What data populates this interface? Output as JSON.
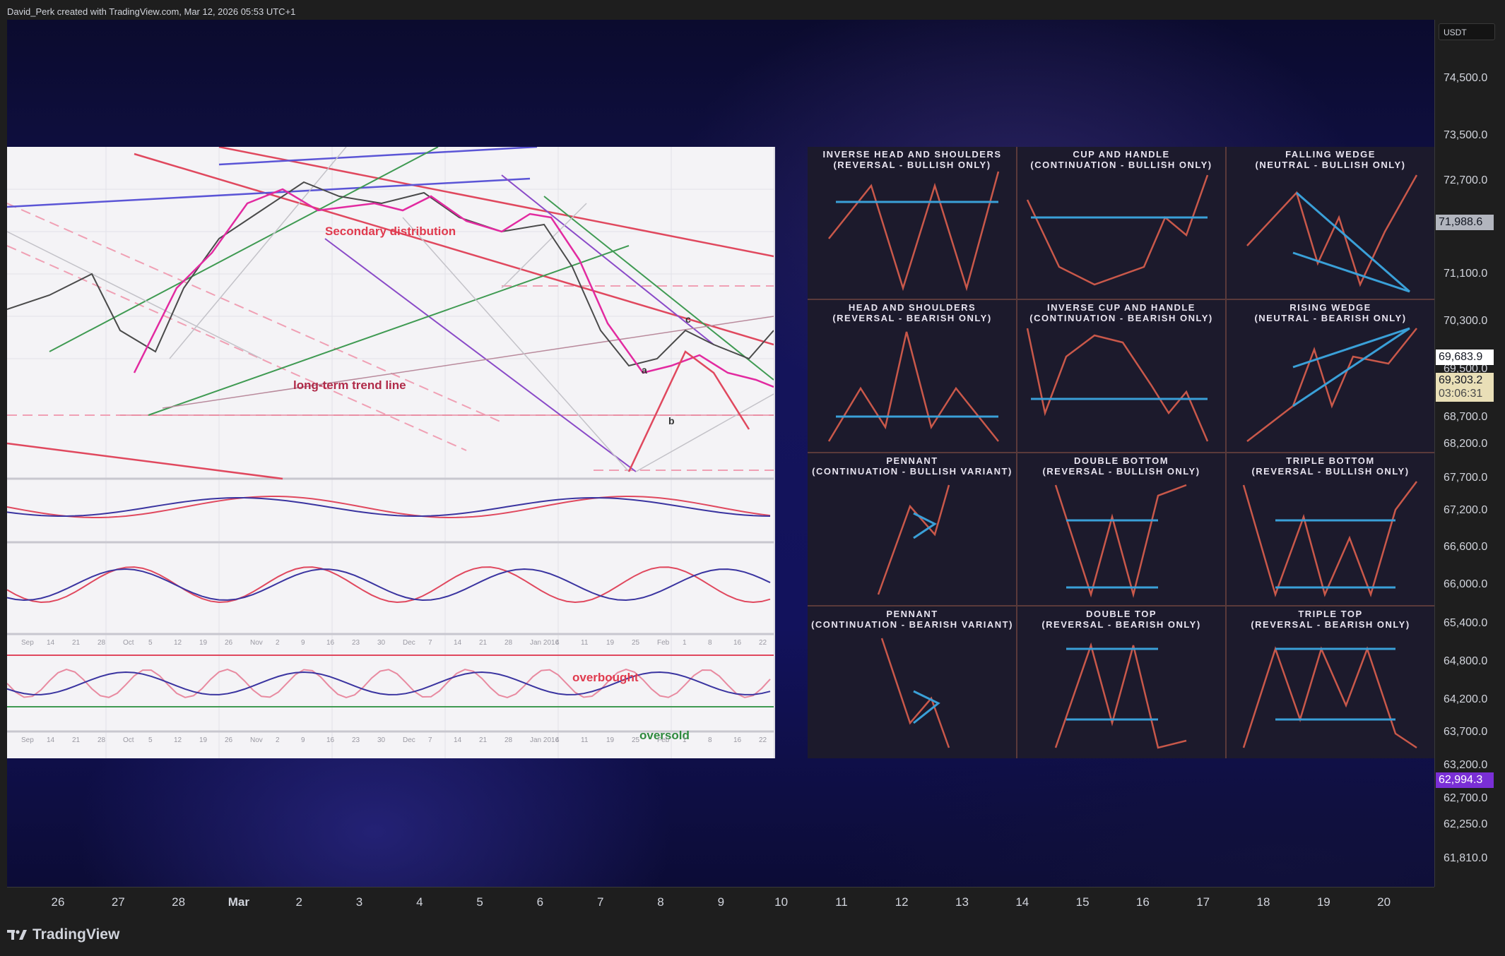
{
  "header": {
    "attribution": "David_Perk created with TradingView.com, Mar 12, 2026 05:53 UTC+1"
  },
  "price_axis": {
    "currency": "USDT",
    "ticks": [
      "74,500.0",
      "73,500.0",
      "72,700.0",
      "71,100.0",
      "70,300.0",
      "69,500.0",
      "68,700.0",
      "68,200.0",
      "67,700.0",
      "67,200.0",
      "66,600.0",
      "66,000.0",
      "65,400.0",
      "64,800.0",
      "64,200.0",
      "63,700.0",
      "63,200.0",
      "62,700.0",
      "62,250.0",
      "61,810.0"
    ],
    "labels": {
      "price_high": "71,988.6",
      "current_price": "69,683.9",
      "price_mid": "69,303.2",
      "countdown": "03:06:31",
      "price_low": "62,994.3"
    },
    "colors": {
      "current": "#ffffff",
      "mid": "#e9dfb7",
      "low": "#7a2fd6",
      "high": "#b2b5be"
    }
  },
  "time_axis": {
    "ticks": [
      "26",
      "27",
      "28",
      "Mar",
      "2",
      "3",
      "4",
      "5",
      "6",
      "7",
      "8",
      "9",
      "10",
      "11",
      "12",
      "13",
      "14",
      "15",
      "16",
      "17",
      "18",
      "19",
      "20"
    ],
    "bold": [
      "Mar"
    ]
  },
  "embedded_left_chart": {
    "annotations": {
      "secondary": "Secondary distribution",
      "trend": "long-term trend line",
      "overbought": "overbought",
      "oversold": "oversold",
      "point_a": "a",
      "point_b": "b",
      "point_c": "c"
    },
    "month_labels_1": [
      "Sep",
      "14",
      "21",
      "28",
      "Oct",
      "5",
      "12",
      "19",
      "26",
      "Nov",
      "2",
      "9",
      "16",
      "23",
      "30",
      "Dec",
      "7",
      "14",
      "21",
      "28",
      "Jan 2016",
      "4",
      "11",
      "19",
      "25",
      "Feb",
      "1",
      "8",
      "16",
      "22"
    ],
    "month_labels_2": [
      "Sep",
      "14",
      "21",
      "28",
      "Oct",
      "5",
      "12",
      "19",
      "26",
      "Nov",
      "2",
      "9",
      "16",
      "23",
      "30",
      "Dec",
      "7",
      "14",
      "21",
      "28",
      "Jan 2016",
      "4",
      "11",
      "19",
      "25",
      "Feb",
      "1",
      "8",
      "16",
      "22"
    ]
  },
  "embedded_right_patterns": [
    {
      "title": "INVERSE HEAD AND SHOULDERS",
      "subtitle": "(REVERSAL - BULLISH ONLY)"
    },
    {
      "title": "CUP AND HANDLE",
      "subtitle": "(CONTINUATION - BULLISH ONLY)"
    },
    {
      "title": "FALLING WEDGE",
      "subtitle": "(NEUTRAL - BULLISH ONLY)"
    },
    {
      "title": "HEAD AND SHOULDERS",
      "subtitle": "(REVERSAL - BEARISH ONLY)"
    },
    {
      "title": "INVERSE CUP AND HANDLE",
      "subtitle": "(CONTINUATION - BEARISH ONLY)"
    },
    {
      "title": "RISING WEDGE",
      "subtitle": "(NEUTRAL - BEARISH ONLY)"
    },
    {
      "title": "PENNANT",
      "subtitle": "(CONTINUATION - BULLISH VARIANT)"
    },
    {
      "title": "DOUBLE BOTTOM",
      "subtitle": "(REVERSAL - BULLISH ONLY)"
    },
    {
      "title": "TRIPLE BOTTOM",
      "subtitle": "(REVERSAL - BULLISH ONLY)"
    },
    {
      "title": "PENNANT",
      "subtitle": "(CONTINUATION - BEARISH VARIANT)"
    },
    {
      "title": "DOUBLE TOP",
      "subtitle": "(REVERSAL - BEARISH ONLY)"
    },
    {
      "title": "TRIPLE TOP",
      "subtitle": "(REVERSAL - BEARISH ONLY)"
    }
  ],
  "footer": {
    "brand": "TradingView",
    "logo_icon": "tradingview-logo-icon"
  }
}
